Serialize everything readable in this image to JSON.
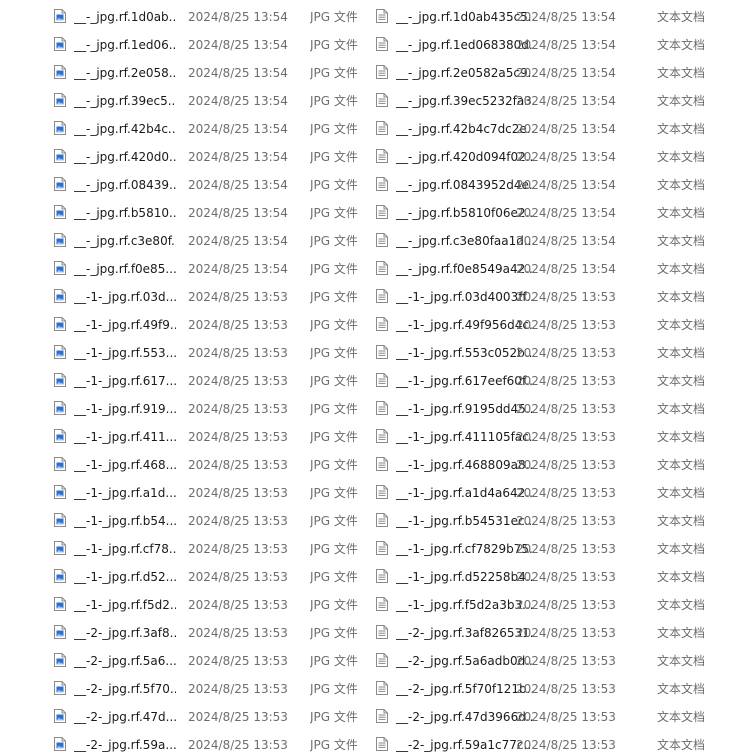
{
  "icons": {
    "left_column": "jpg-image-file-icon",
    "right_column": "text-document-icon"
  },
  "colors": {
    "jpg_icon_blue": "#2f6fcf",
    "text_icon_gray": "#8a8a8a",
    "secondary_text": "#6d6d6d"
  },
  "rows": [
    {
      "jpg_name": "__-_jpg.rf.1d0ab...",
      "jpg_date": "2024/8/25 13:54",
      "jpg_type": "JPG 文件",
      "txt_name": "__-_jpg.rf.1d0ab435c5...",
      "txt_date": "2024/8/25 13:54",
      "txt_type": "文本文档"
    },
    {
      "jpg_name": "__-_jpg.rf.1ed06...",
      "jpg_date": "2024/8/25 13:54",
      "jpg_type": "JPG 文件",
      "txt_name": "__-_jpg.rf.1ed068380d...",
      "txt_date": "2024/8/25 13:54",
      "txt_type": "文本文档"
    },
    {
      "jpg_name": "__-_jpg.rf.2e058...",
      "jpg_date": "2024/8/25 13:54",
      "jpg_type": "JPG 文件",
      "txt_name": "__-_jpg.rf.2e0582a5c9...",
      "txt_date": "2024/8/25 13:54",
      "txt_type": "文本文档"
    },
    {
      "jpg_name": "__-_jpg.rf.39ec5...",
      "jpg_date": "2024/8/25 13:54",
      "jpg_type": "JPG 文件",
      "txt_name": "__-_jpg.rf.39ec5232fa3...",
      "txt_date": "2024/8/25 13:54",
      "txt_type": "文本文档"
    },
    {
      "jpg_name": "__-_jpg.rf.42b4c...",
      "jpg_date": "2024/8/25 13:54",
      "jpg_type": "JPG 文件",
      "txt_name": "__-_jpg.rf.42b4c7dc2e...",
      "txt_date": "2024/8/25 13:54",
      "txt_type": "文本文档"
    },
    {
      "jpg_name": "__-_jpg.rf.420d0...",
      "jpg_date": "2024/8/25 13:54",
      "jpg_type": "JPG 文件",
      "txt_name": "__-_jpg.rf.420d094f02...",
      "txt_date": "2024/8/25 13:54",
      "txt_type": "文本文档"
    },
    {
      "jpg_name": "__-_jpg.rf.08439...",
      "jpg_date": "2024/8/25 13:54",
      "jpg_type": "JPG 文件",
      "txt_name": "__-_jpg.rf.0843952d4e...",
      "txt_date": "2024/8/25 13:54",
      "txt_type": "文本文档"
    },
    {
      "jpg_name": "__-_jpg.rf.b5810...",
      "jpg_date": "2024/8/25 13:54",
      "jpg_type": "JPG 文件",
      "txt_name": "__-_jpg.rf.b5810f06e2...",
      "txt_date": "2024/8/25 13:54",
      "txt_type": "文本文档"
    },
    {
      "jpg_name": "__-_jpg.rf.c3e80f...",
      "jpg_date": "2024/8/25 13:54",
      "jpg_type": "JPG 文件",
      "txt_name": "__-_jpg.rf.c3e80faa1d...",
      "txt_date": "2024/8/25 13:54",
      "txt_type": "文本文档"
    },
    {
      "jpg_name": "__-_jpg.rf.f0e85...",
      "jpg_date": "2024/8/25 13:54",
      "jpg_type": "JPG 文件",
      "txt_name": "__-_jpg.rf.f0e8549a42...",
      "txt_date": "2024/8/25 13:54",
      "txt_type": "文本文档"
    },
    {
      "jpg_name": "__-1-_jpg.rf.03d...",
      "jpg_date": "2024/8/25 13:53",
      "jpg_type": "JPG 文件",
      "txt_name": "__-1-_jpg.rf.03d4003ff...",
      "txt_date": "2024/8/25 13:53",
      "txt_type": "文本文档"
    },
    {
      "jpg_name": "__-1-_jpg.rf.49f9...",
      "jpg_date": "2024/8/25 13:53",
      "jpg_type": "JPG 文件",
      "txt_name": "__-1-_jpg.rf.49f956d4c...",
      "txt_date": "2024/8/25 13:53",
      "txt_type": "文本文档"
    },
    {
      "jpg_name": "__-1-_jpg.rf.553...",
      "jpg_date": "2024/8/25 13:53",
      "jpg_type": "JPG 文件",
      "txt_name": "__-1-_jpg.rf.553c052b...",
      "txt_date": "2024/8/25 13:53",
      "txt_type": "文本文档"
    },
    {
      "jpg_name": "__-1-_jpg.rf.617...",
      "jpg_date": "2024/8/25 13:53",
      "jpg_type": "JPG 文件",
      "txt_name": "__-1-_jpg.rf.617eef60f...",
      "txt_date": "2024/8/25 13:53",
      "txt_type": "文本文档"
    },
    {
      "jpg_name": "__-1-_jpg.rf.919...",
      "jpg_date": "2024/8/25 13:53",
      "jpg_type": "JPG 文件",
      "txt_name": "__-1-_jpg.rf.9195dd45...",
      "txt_date": "2024/8/25 13:53",
      "txt_type": "文本文档"
    },
    {
      "jpg_name": "__-1-_jpg.rf.411...",
      "jpg_date": "2024/8/25 13:53",
      "jpg_type": "JPG 文件",
      "txt_name": "__-1-_jpg.rf.411105fac...",
      "txt_date": "2024/8/25 13:53",
      "txt_type": "文本文档"
    },
    {
      "jpg_name": "__-1-_jpg.rf.468...",
      "jpg_date": "2024/8/25 13:53",
      "jpg_type": "JPG 文件",
      "txt_name": "__-1-_jpg.rf.468809a8...",
      "txt_date": "2024/8/25 13:53",
      "txt_type": "文本文档"
    },
    {
      "jpg_name": "__-1-_jpg.rf.a1d...",
      "jpg_date": "2024/8/25 13:53",
      "jpg_type": "JPG 文件",
      "txt_name": "__-1-_jpg.rf.a1d4a642...",
      "txt_date": "2024/8/25 13:53",
      "txt_type": "文本文档"
    },
    {
      "jpg_name": "__-1-_jpg.rf.b54...",
      "jpg_date": "2024/8/25 13:53",
      "jpg_type": "JPG 文件",
      "txt_name": "__-1-_jpg.rf.b54531ec...",
      "txt_date": "2024/8/25 13:53",
      "txt_type": "文本文档"
    },
    {
      "jpg_name": "__-1-_jpg.rf.cf78...",
      "jpg_date": "2024/8/25 13:53",
      "jpg_type": "JPG 文件",
      "txt_name": "__-1-_jpg.rf.cf7829b75...",
      "txt_date": "2024/8/25 13:53",
      "txt_type": "文本文档"
    },
    {
      "jpg_name": "__-1-_jpg.rf.d52...",
      "jpg_date": "2024/8/25 13:53",
      "jpg_type": "JPG 文件",
      "txt_name": "__-1-_jpg.rf.d52258b4...",
      "txt_date": "2024/8/25 13:53",
      "txt_type": "文本文档"
    },
    {
      "jpg_name": "__-1-_jpg.rf.f5d2...",
      "jpg_date": "2024/8/25 13:53",
      "jpg_type": "JPG 文件",
      "txt_name": "__-1-_jpg.rf.f5d2a3b3...",
      "txt_date": "2024/8/25 13:53",
      "txt_type": "文本文档"
    },
    {
      "jpg_name": "__-2-_jpg.rf.3af8...",
      "jpg_date": "2024/8/25 13:53",
      "jpg_type": "JPG 文件",
      "txt_name": "__-2-_jpg.rf.3af826531...",
      "txt_date": "2024/8/25 13:53",
      "txt_type": "文本文档"
    },
    {
      "jpg_name": "__-2-_jpg.rf.5a6...",
      "jpg_date": "2024/8/25 13:53",
      "jpg_type": "JPG 文件",
      "txt_name": "__-2-_jpg.rf.5a6adb0d...",
      "txt_date": "2024/8/25 13:53",
      "txt_type": "文本文档"
    },
    {
      "jpg_name": "__-2-_jpg.rf.5f70...",
      "jpg_date": "2024/8/25 13:53",
      "jpg_type": "JPG 文件",
      "txt_name": "__-2-_jpg.rf.5f70f121b...",
      "txt_date": "2024/8/25 13:53",
      "txt_type": "文本文档"
    },
    {
      "jpg_name": "__-2-_jpg.rf.47d...",
      "jpg_date": "2024/8/25 13:53",
      "jpg_type": "JPG 文件",
      "txt_name": "__-2-_jpg.rf.47d3966d...",
      "txt_date": "2024/8/25 13:53",
      "txt_type": "文本文档"
    },
    {
      "jpg_name": "__-2-_jpg.rf.59a...",
      "jpg_date": "2024/8/25 13:53",
      "jpg_type": "JPG 文件",
      "txt_name": "__-2-_jpg.rf.59a1c77c...",
      "txt_date": "2024/8/25 13:53",
      "txt_type": "文本文档"
    }
  ]
}
